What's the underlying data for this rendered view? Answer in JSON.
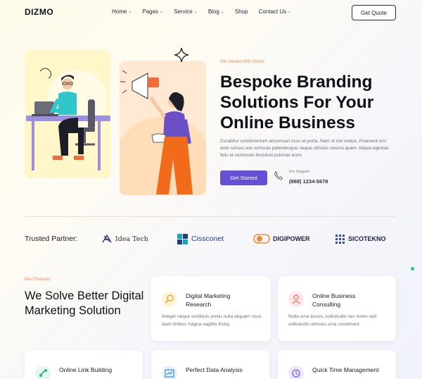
{
  "header": {
    "logo": "DIZMO",
    "nav": [
      {
        "label": "Home",
        "dropdown": true
      },
      {
        "label": "Pages",
        "dropdown": true
      },
      {
        "label": "Service",
        "dropdown": true
      },
      {
        "label": "Blog",
        "dropdown": true
      },
      {
        "label": "Shop",
        "dropdown": false
      },
      {
        "label": "Contact Us",
        "dropdown": true
      }
    ],
    "cta": "Get Quote"
  },
  "hero": {
    "eyebrow": "Get Started With Dizmo",
    "title": "Bespoke Branding Solutions For Your Online Business",
    "description": "Curabitur condimentum accumsan risus et porta. Nam ut nisi metus. Praesent orci ante cursus non vehicula pellentesque neque ultricies viverra quam. Aliqua egestas felis et commodo tincidunt pulvinar enim.",
    "button": "Get Started",
    "support_label": "For Support",
    "support_phone": "(888) 1234-5678"
  },
  "partners": {
    "label": "Trusted Partner:",
    "items": [
      {
        "name": "Idea Tech",
        "icon": "idea-tech-logo-icon"
      },
      {
        "name": "Cissconet",
        "icon": "cissconet-logo-icon"
      },
      {
        "name": "DIGIPOWER",
        "icon": "digipower-logo-icon"
      },
      {
        "name": "SICOTEKNO",
        "icon": "sicotekno-logo-icon"
      }
    ]
  },
  "features": {
    "eyebrow": "Best Features",
    "title": "We Solve Better Digital Marketing Solution",
    "cards": [
      {
        "title": "Digital Marketing Research",
        "description": "Integer neque vestibulu pretiu nulla aliquam risus diam finibus magna sagittis tristiq.",
        "icon": "magnifier-icon",
        "icon_bg": "#fff4d6"
      },
      {
        "title": "Online Business Consulting",
        "description": "Nulla urna ipsum, sollicitudin nec lorem sed sollicitudin ultricies urna condiment.",
        "icon": "consulting-person-icon",
        "icon_bg": "#ffe6e6"
      },
      {
        "title": "Online Link Building",
        "description": "",
        "icon": "link-icon",
        "icon_bg": "#e3f7ef"
      },
      {
        "title": "Perfect Data Analysis",
        "description": "",
        "icon": "data-chart-icon",
        "icon_bg": "#e2f1fb"
      },
      {
        "title": "Quick Time Management",
        "description": "",
        "icon": "clock-icon",
        "icon_bg": "#ece8fb"
      }
    ]
  },
  "colors": {
    "accent": "#6750d8",
    "eyebrow": "#f08a5d",
    "status_dot": "#2ecc71"
  }
}
